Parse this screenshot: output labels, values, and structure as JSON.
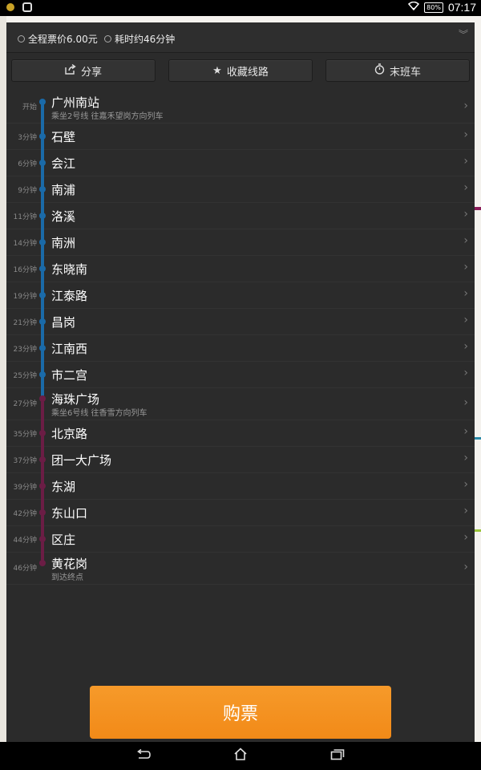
{
  "status_bar": {
    "wifi_icon": "wifi-icon",
    "battery": "80%",
    "time": "07:17"
  },
  "route": {
    "fare": "全程票价6.00元",
    "duration": "耗时约46分钟"
  },
  "toolbar": {
    "share": "分享",
    "favorite": "收藏线路",
    "last_train": "末班车"
  },
  "colors": {
    "line2": "#1a6aa8",
    "line6": "#6b1d45",
    "buy_button": "#f28a18"
  },
  "stations": [
    {
      "time": "开始",
      "name": "广州南站",
      "sub": "乘坐2号线 往嘉禾望岗方向列车",
      "line": "line2"
    },
    {
      "time": "3分钟",
      "name": "石壁",
      "line": "line2"
    },
    {
      "time": "6分钟",
      "name": "会江",
      "line": "line2"
    },
    {
      "time": "9分钟",
      "name": "南浦",
      "line": "line2"
    },
    {
      "time": "11分钟",
      "name": "洛溪",
      "line": "line2"
    },
    {
      "time": "14分钟",
      "name": "南洲",
      "line": "line2"
    },
    {
      "time": "16分钟",
      "name": "东晓南",
      "line": "line2"
    },
    {
      "time": "19分钟",
      "name": "江泰路",
      "line": "line2"
    },
    {
      "time": "21分钟",
      "name": "昌岗",
      "line": "line2"
    },
    {
      "time": "23分钟",
      "name": "江南西",
      "line": "line2"
    },
    {
      "time": "25分钟",
      "name": "市二宫",
      "line": "line2"
    },
    {
      "time": "27分钟",
      "name": "海珠广场",
      "sub": "乘坐6号线 往香雪方向列车",
      "line": "line6"
    },
    {
      "time": "35分钟",
      "name": "北京路",
      "line": "line6"
    },
    {
      "time": "37分钟",
      "name": "团一大广场",
      "line": "line6"
    },
    {
      "time": "39分钟",
      "name": "东湖",
      "line": "line6"
    },
    {
      "time": "42分钟",
      "name": "东山口",
      "line": "line6"
    },
    {
      "time": "44分钟",
      "name": "区庄",
      "line": "line6"
    },
    {
      "time": "46分钟",
      "name": "黄花岗",
      "sub": "到达终点",
      "line": "line6"
    }
  ],
  "buy_button": "购票"
}
